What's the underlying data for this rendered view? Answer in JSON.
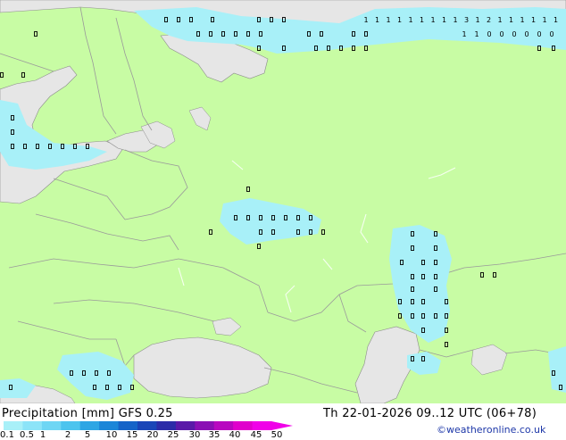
{
  "colors": {
    "land": "#c8fca4",
    "sea": "#e6e6e6",
    "border": "#9a9a9a",
    "coast": "#8c8c8c",
    "precip_light": "#a8f0f8",
    "precip_mid": "#7de0f0"
  },
  "footer": {
    "title": "Precipitation [mm] GFS 0.25",
    "run": "Th 22-01-2026 09..12 UTC (06+78)",
    "credit": "©weatheronline.co.uk"
  },
  "legend": {
    "ticks": [
      "0.1",
      "0.5",
      "1",
      "2",
      "5",
      "10",
      "15",
      "20",
      "25",
      "30",
      "35",
      "40",
      "45",
      "50"
    ],
    "colors": [
      "#a8f0f8",
      "#8ce4f8",
      "#6ed6f4",
      "#4cc4ee",
      "#2ea6e4",
      "#1c86d8",
      "#1664c8",
      "#1a46b8",
      "#2c2ca8",
      "#5a1aa8",
      "#8a10b4",
      "#b808c0",
      "#e000cc",
      "#f000e8"
    ]
  },
  "precip_labels": [
    "0",
    "0",
    "0",
    "0",
    "0",
    "0",
    "0",
    "0",
    "0",
    "0",
    "0",
    "0",
    "0",
    "0",
    "0",
    "0",
    "0",
    "0",
    "0",
    "0",
    "1",
    "1",
    "1",
    "1",
    "1",
    "1",
    "1",
    "1",
    "1",
    "3",
    "1",
    "2",
    "1",
    "1",
    "1",
    "1",
    "1",
    "1",
    "1",
    "1"
  ]
}
